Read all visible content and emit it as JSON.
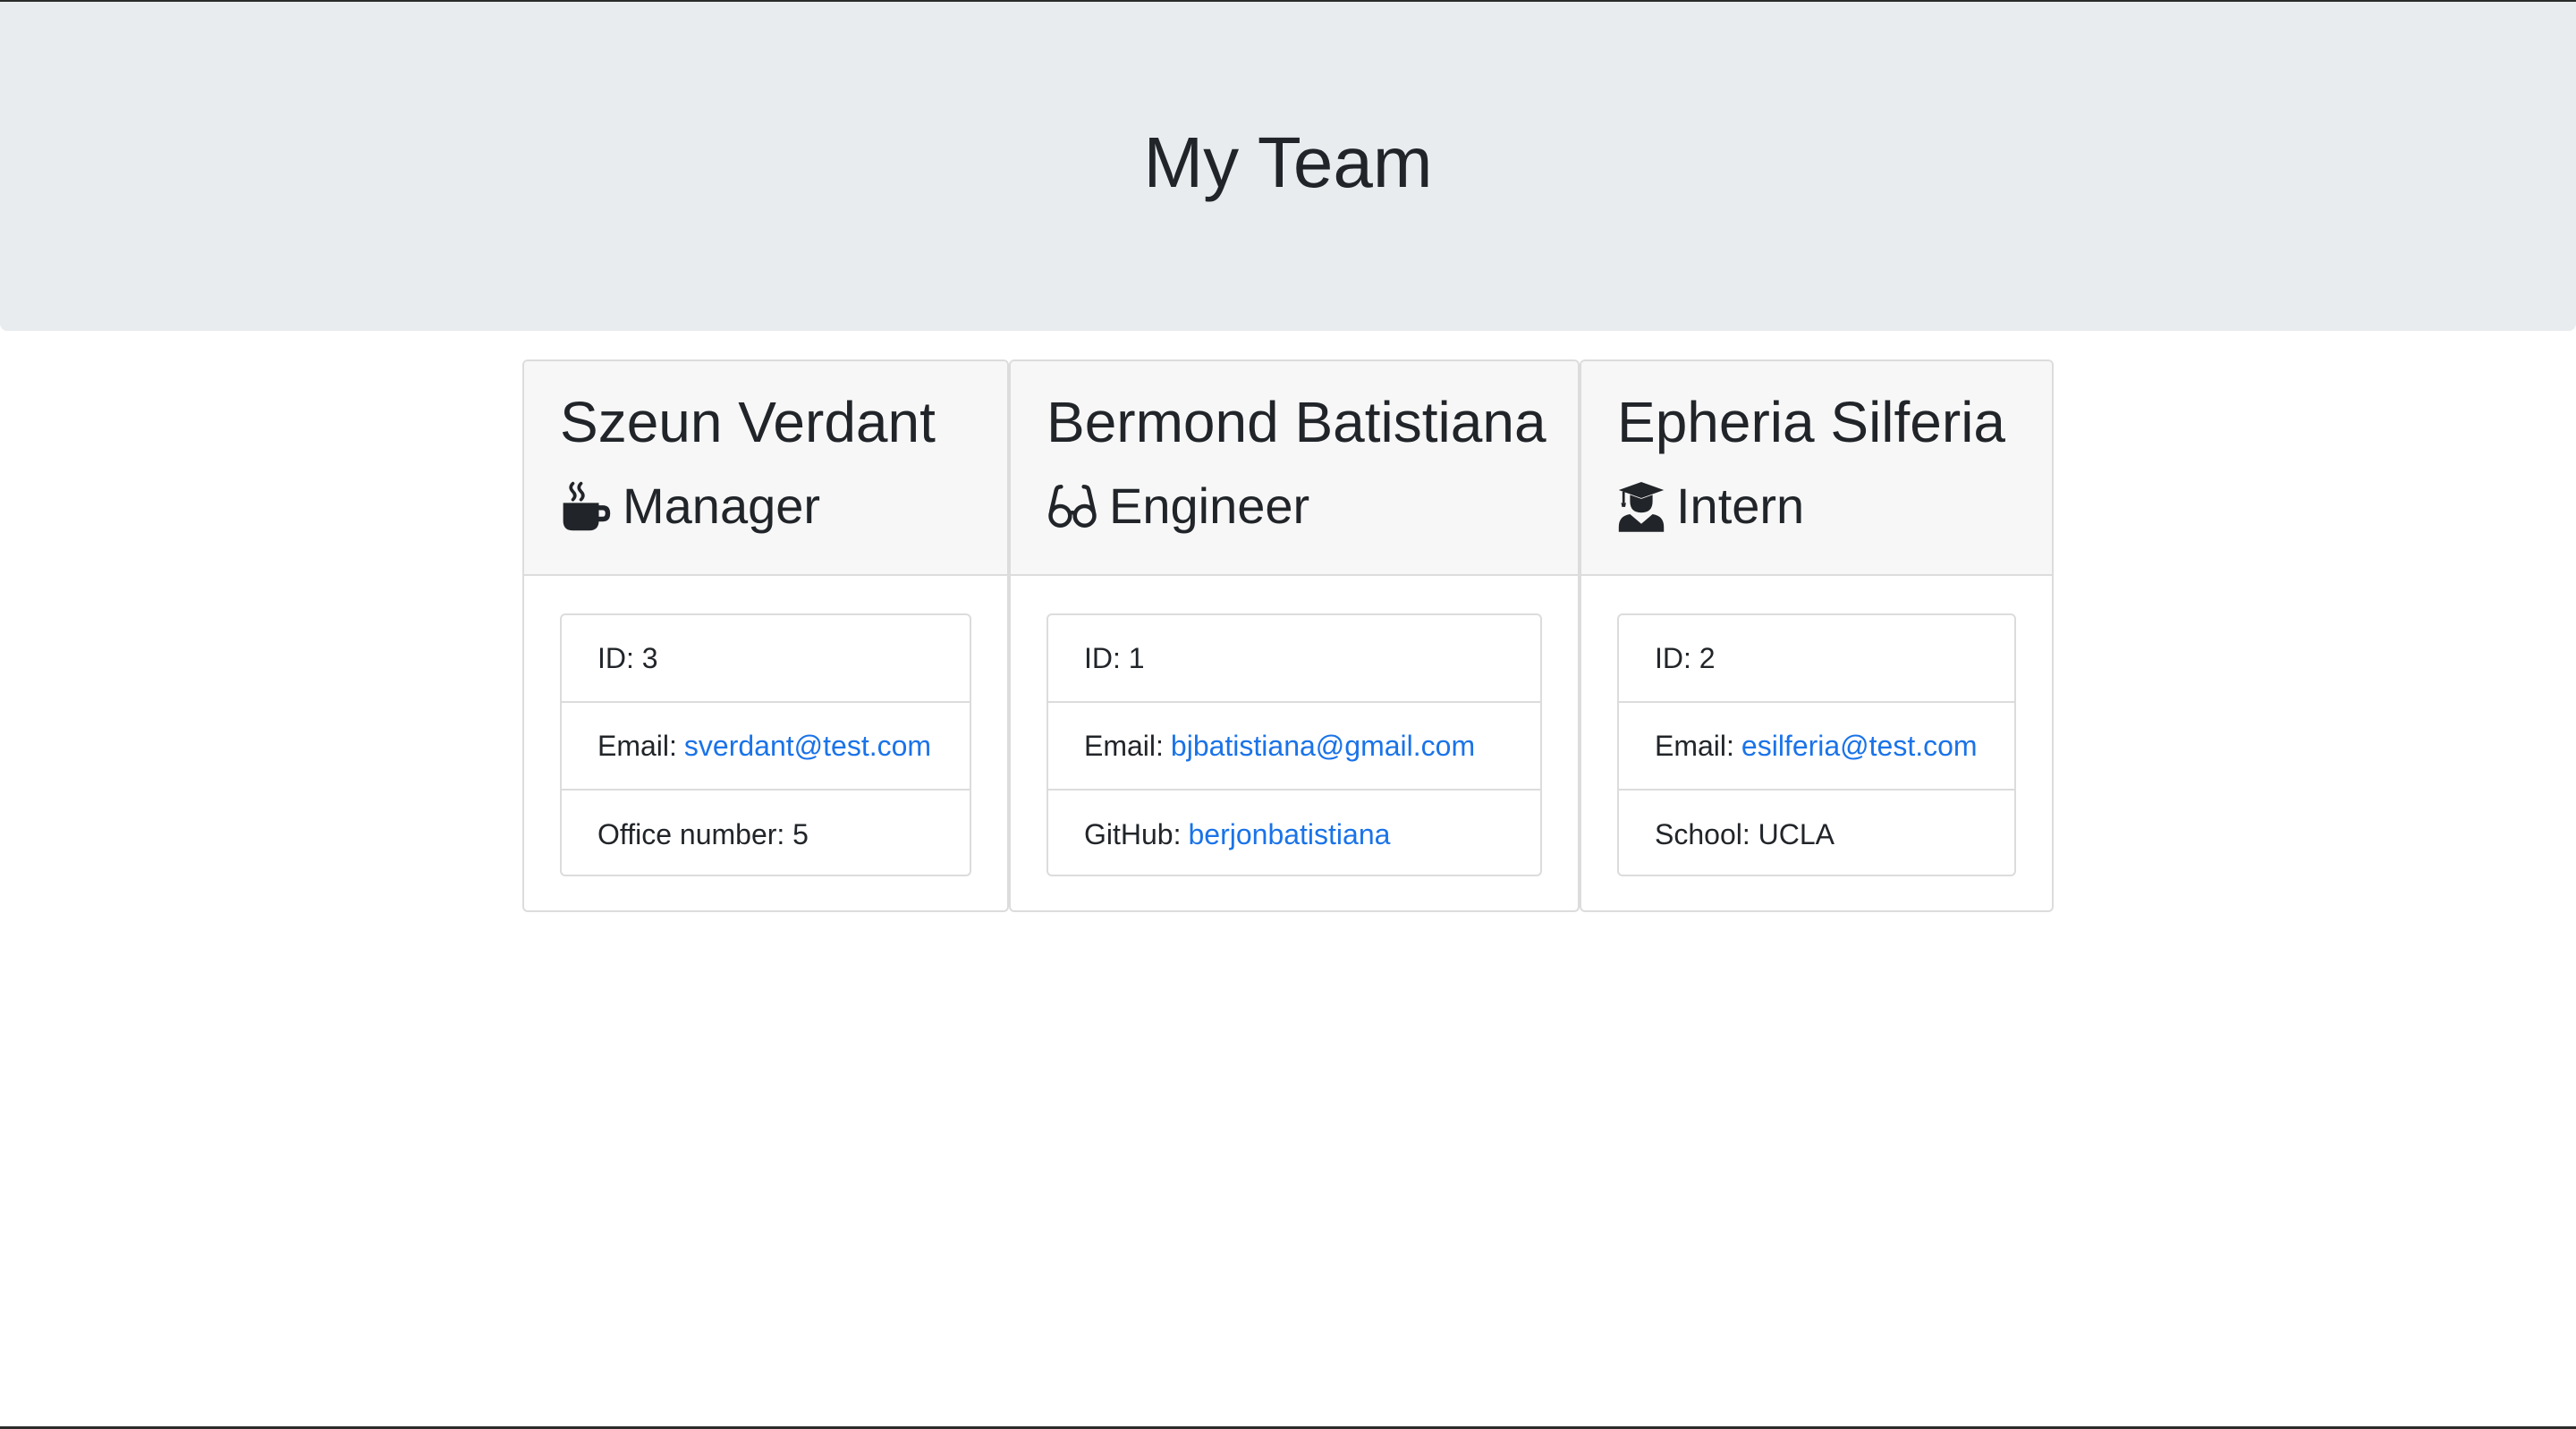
{
  "header": {
    "title": "My Team"
  },
  "colors": {
    "link": "#1a73e8",
    "jumbotron_bg": "#e9ecef",
    "card_header_bg": "#f7f7f7",
    "text": "#212529"
  },
  "employees": [
    {
      "name": "Szeun Verdant",
      "role": "Manager",
      "role_icon": "coffee-mug-icon",
      "id_label": "ID:",
      "id": "3",
      "email_label": "Email:",
      "email": "sverdant@test.com",
      "extra_label": "Office number:",
      "extra_value": "5"
    },
    {
      "name": "Bermond Batistiana",
      "role": "Engineer",
      "role_icon": "glasses-icon",
      "id_label": "ID:",
      "id": "1",
      "email_label": "Email:",
      "email": "bjbatistiana@gmail.com",
      "extra_label": "GitHub:",
      "extra_value": "berjonbatistiana"
    },
    {
      "name": "Epheria Silferia",
      "role": "Intern",
      "role_icon": "graduate-icon",
      "id_label": "ID:",
      "id": "2",
      "email_label": "Email:",
      "email": "esilferia@test.com",
      "extra_label": "School:",
      "extra_value": "UCLA"
    }
  ]
}
